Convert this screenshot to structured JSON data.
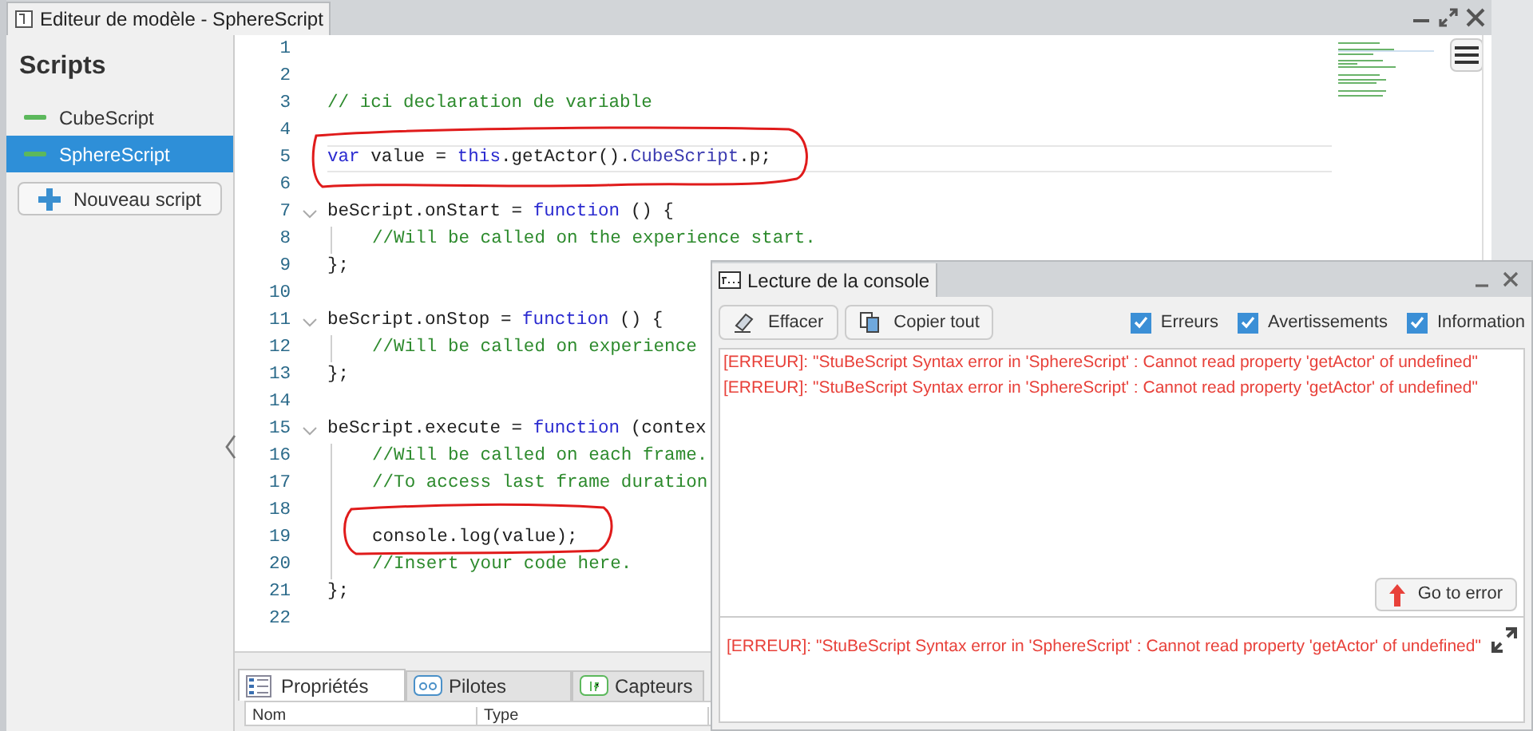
{
  "window": {
    "title": "Editeur de modèle - SphereScript"
  },
  "sidebar": {
    "heading": "Scripts",
    "items": [
      {
        "label": "CubeScript",
        "selected": false
      },
      {
        "label": "SphereScript",
        "selected": true
      }
    ],
    "new_button": "Nouveau script"
  },
  "code_lines": [
    {
      "number": "1"
    },
    {
      "number": "2"
    },
    {
      "number": "3",
      "tokens": [
        {
          "kind": "comment",
          "text": "// ici declaration de variable"
        }
      ]
    },
    {
      "number": "4"
    },
    {
      "number": "5",
      "current": true,
      "tokens": [
        {
          "kind": "keyword",
          "text": "var"
        },
        {
          "kind": "plain",
          "text": " value = "
        },
        {
          "kind": "keyword",
          "text": "this"
        },
        {
          "kind": "plain",
          "text": ".getActor()."
        },
        {
          "kind": "ident",
          "text": "CubeScript"
        },
        {
          "kind": "plain",
          "text": ".p;"
        }
      ]
    },
    {
      "number": "6"
    },
    {
      "number": "7",
      "foldable": true,
      "tokens": [
        {
          "kind": "plain",
          "text": "beScript.onStart = "
        },
        {
          "kind": "keyword",
          "text": "function"
        },
        {
          "kind": "plain",
          "text": " () {"
        }
      ]
    },
    {
      "number": "8",
      "indented": true,
      "tokens": [
        {
          "kind": "comment",
          "text": "//Will be called on the experience start."
        }
      ]
    },
    {
      "number": "9",
      "tokens": [
        {
          "kind": "plain",
          "text": "};"
        }
      ]
    },
    {
      "number": "10"
    },
    {
      "number": "11",
      "foldable": true,
      "tokens": [
        {
          "kind": "plain",
          "text": "beScript.onStop = "
        },
        {
          "kind": "keyword",
          "text": "function"
        },
        {
          "kind": "plain",
          "text": " () {"
        }
      ]
    },
    {
      "number": "12",
      "indented": true,
      "tokens": [
        {
          "kind": "comment",
          "text": "//Will be called on experience"
        }
      ]
    },
    {
      "number": "13",
      "tokens": [
        {
          "kind": "plain",
          "text": "};"
        }
      ]
    },
    {
      "number": "14"
    },
    {
      "number": "15",
      "foldable": true,
      "tokens": [
        {
          "kind": "plain",
          "text": "beScript.execute = "
        },
        {
          "kind": "keyword",
          "text": "function"
        },
        {
          "kind": "plain",
          "text": " (contex"
        }
      ]
    },
    {
      "number": "16",
      "indented": true,
      "tokens": [
        {
          "kind": "comment",
          "text": "//Will be called on each frame."
        }
      ]
    },
    {
      "number": "17",
      "indented": true,
      "tokens": [
        {
          "kind": "comment",
          "text": "//To access last frame duration"
        }
      ]
    },
    {
      "number": "18",
      "indented": true
    },
    {
      "number": "19",
      "indented": true,
      "tokens": [
        {
          "kind": "plain",
          "text": "console.log(value);"
        }
      ]
    },
    {
      "number": "20",
      "indented": true,
      "tokens": [
        {
          "kind": "comment",
          "text": "//Insert your code here."
        }
      ]
    },
    {
      "number": "21",
      "tokens": [
        {
          "kind": "plain",
          "text": "};"
        }
      ]
    },
    {
      "number": "22"
    }
  ],
  "bottom_tabs": [
    {
      "label": "Propriétés",
      "selected": true
    },
    {
      "label": "Pilotes",
      "selected": false
    },
    {
      "label": "Capteurs",
      "selected": false
    }
  ],
  "properties_columns": [
    "Nom",
    "Type"
  ],
  "console": {
    "title": "Lecture de la console",
    "buttons": [
      "Effacer",
      "Copier tout"
    ],
    "filters": [
      {
        "label": "Erreurs",
        "checked": true
      },
      {
        "label": "Avertissements",
        "checked": true
      },
      {
        "label": "Information",
        "checked": true
      }
    ],
    "messages": [
      "[ERREUR]: \"StuBeScript Syntax error in 'SphereScript' : Cannot read property 'getActor' of undefined\"",
      "[ERREUR]: \"StuBeScript Syntax error in 'SphereScript' : Cannot read property 'getActor' of undefined\""
    ],
    "go_button": "Go to error",
    "detail": "[ERREUR]: \"StuBeScript Syntax error in 'SphereScript' : Cannot read property 'getActor' of undefined\""
  }
}
